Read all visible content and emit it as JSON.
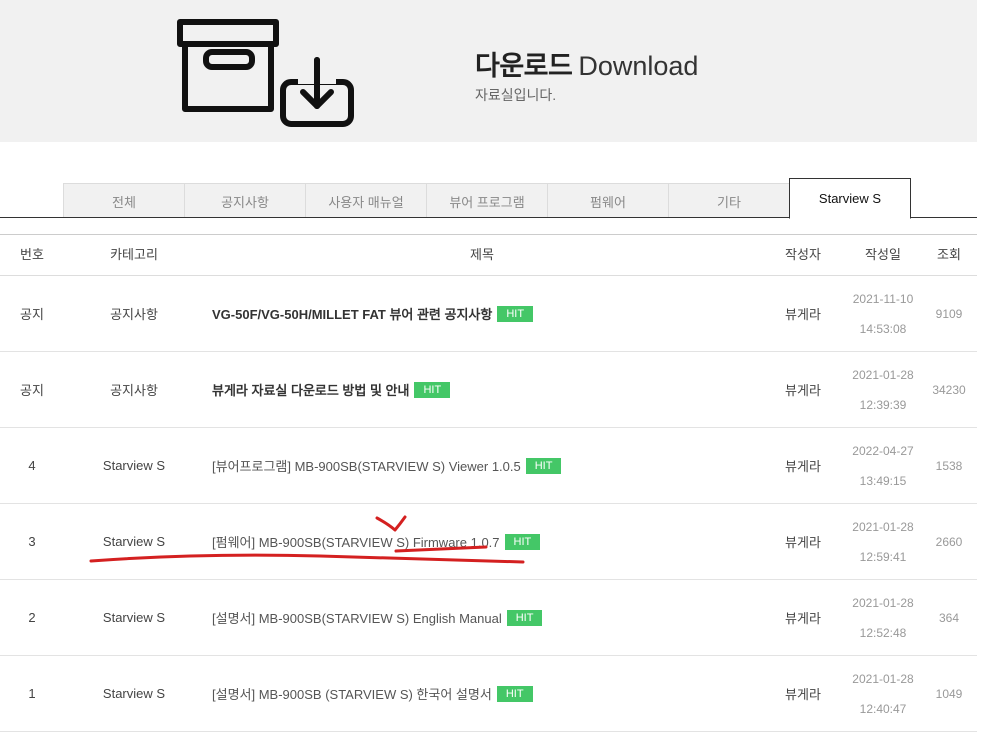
{
  "banner": {
    "title_ko": "다운로드",
    "title_en": "Download",
    "subtitle": "자료실입니다."
  },
  "tabs": [
    {
      "label": "전체",
      "active": false
    },
    {
      "label": "공지사항",
      "active": false
    },
    {
      "label": "사용자 매뉴얼",
      "active": false
    },
    {
      "label": "뷰어 프로그램",
      "active": false
    },
    {
      "label": "펌웨어",
      "active": false
    },
    {
      "label": "기타",
      "active": false
    },
    {
      "label": "Starview S",
      "active": true
    }
  ],
  "table": {
    "headers": {
      "num": "번호",
      "category": "카테고리",
      "title": "제목",
      "author": "작성자",
      "date": "작성일",
      "views": "조회"
    },
    "rows": [
      {
        "num": "공지",
        "category": "공지사항",
        "title": "VG-50F/VG-50H/MILLET FAT 뷰어 관련 공지사항",
        "bold": true,
        "badge": "HIT",
        "author": "뷰게라",
        "date": "2021-11-10",
        "time": "14:53:08",
        "views": "9109"
      },
      {
        "num": "공지",
        "category": "공지사항",
        "title": "뷰게라 자료실 다운로드 방법 및 안내",
        "bold": true,
        "badge": "HIT",
        "author": "뷰게라",
        "date": "2021-01-28",
        "time": "12:39:39",
        "views": "34230"
      },
      {
        "num": "4",
        "category": "Starview S",
        "title": "[뷰어프로그램] MB-900SB(STARVIEW S) Viewer 1.0.5",
        "bold": false,
        "badge": "HIT",
        "author": "뷰게라",
        "date": "2022-04-27",
        "time": "13:49:15",
        "views": "1538"
      },
      {
        "num": "3",
        "category": "Starview S",
        "title": "[펌웨어] MB-900SB(STARVIEW S) Firmware 1.0.7",
        "bold": false,
        "badge": "HIT",
        "author": "뷰게라",
        "date": "2021-01-28",
        "time": "12:59:41",
        "views": "2660"
      },
      {
        "num": "2",
        "category": "Starview S",
        "title": "[설명서] MB-900SB(STARVIEW S) English Manual",
        "bold": false,
        "badge": "HIT",
        "author": "뷰게라",
        "date": "2021-01-28",
        "time": "12:52:48",
        "views": "364"
      },
      {
        "num": "1",
        "category": "Starview S",
        "title": "[설명서] MB-900SB (STARVIEW S) 한국어 설명서",
        "bold": false,
        "badge": "HIT",
        "author": "뷰게라",
        "date": "2021-01-28",
        "time": "12:40:47",
        "views": "1049"
      }
    ]
  },
  "colors": {
    "hit_badge": "#44c767",
    "annotation": "#d42020",
    "banner_bg": "#f1f1f1"
  },
  "icons": {
    "banner": "archive-download-icon"
  }
}
